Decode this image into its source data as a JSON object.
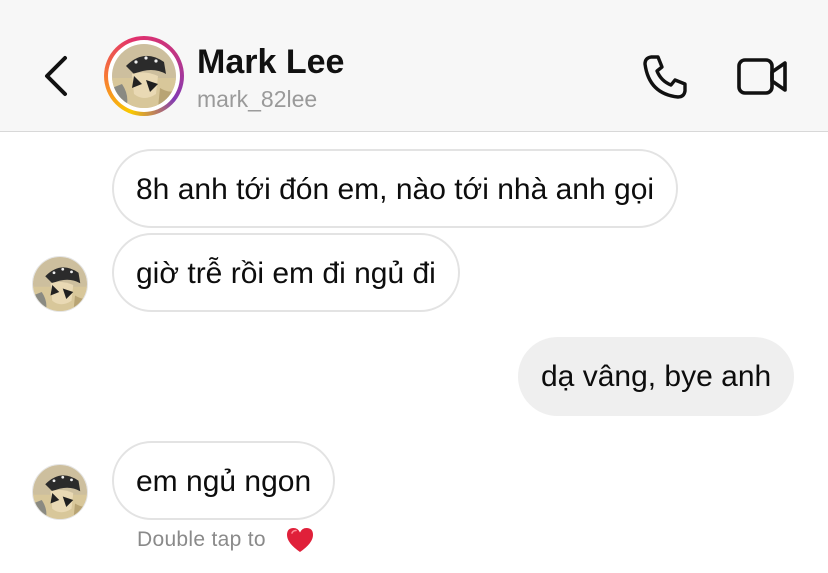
{
  "header": {
    "back_icon": "chevron-left-icon",
    "name": "Mark Lee",
    "username": "mark_82lee",
    "call_icon": "phone-icon",
    "video_icon": "video-camera-icon",
    "story_ring_colors": [
      "#f9c900",
      "#f77737",
      "#e1306c",
      "#c13584",
      "#833ab4"
    ]
  },
  "messages": [
    {
      "direction": "incoming",
      "text": "8h anh tới đón em, nào tới nhà anh gọi"
    },
    {
      "direction": "incoming",
      "text": "giờ trễ rồi em đi ngủ đi"
    },
    {
      "direction": "outgoing",
      "text": "dạ vâng, bye anh"
    },
    {
      "direction": "incoming",
      "text": "em ngủ ngon"
    }
  ],
  "reaction_hint": {
    "text": "Double tap to",
    "icon": "heart-icon",
    "color": "#e0203a"
  },
  "colors": {
    "header_bg": "#f7f7f7",
    "incoming_border": "#e3e3e3",
    "outgoing_bg": "#efefef",
    "secondary_text": "#9a9a9a"
  }
}
